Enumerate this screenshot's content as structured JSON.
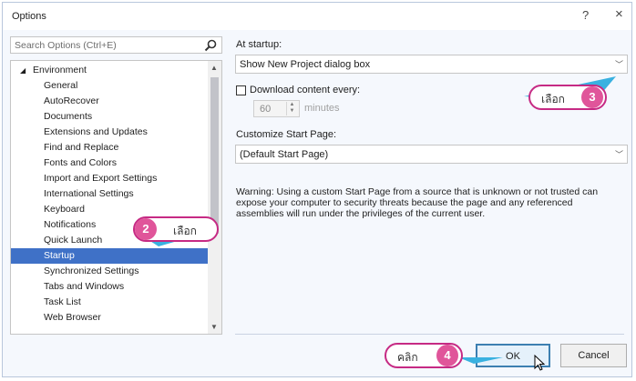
{
  "window": {
    "title": "Options",
    "help_label": "?",
    "close_label": "×"
  },
  "search": {
    "placeholder": "Search Options (Ctrl+E)"
  },
  "tree": {
    "root_label": "Environment",
    "items": [
      {
        "label": "General"
      },
      {
        "label": "AutoRecover"
      },
      {
        "label": "Documents"
      },
      {
        "label": "Extensions and Updates"
      },
      {
        "label": "Find and Replace"
      },
      {
        "label": "Fonts and Colors"
      },
      {
        "label": "Import and Export Settings"
      },
      {
        "label": "International Settings"
      },
      {
        "label": "Keyboard"
      },
      {
        "label": "Notifications"
      },
      {
        "label": "Quick Launch"
      },
      {
        "label": "Startup"
      },
      {
        "label": "Synchronized Settings"
      },
      {
        "label": "Tabs and Windows"
      },
      {
        "label": "Task List"
      },
      {
        "label": "Web Browser"
      }
    ],
    "selected": "Startup"
  },
  "startup": {
    "at_startup_label": "At startup:",
    "at_startup_value": "Show New Project dialog box",
    "download_label": "Download content every:",
    "download_value": "60",
    "minutes_label": "minutes",
    "custom_start_label": "Customize Start Page:",
    "custom_start_value": "(Default Start Page)",
    "warning_line1": "Warning: Using a custom Start Page from a source that is unknown or not trusted can",
    "warning_line2": "expose your computer to security threats because the page and any referenced",
    "warning_line3": "assemblies will run under the privileges of the current user."
  },
  "buttons": {
    "ok": "OK",
    "cancel": "Cancel"
  },
  "callouts": [
    {
      "number": "2",
      "text": "เลือก"
    },
    {
      "number": "3",
      "text": "เลือก"
    },
    {
      "number": "4",
      "text": "คลิก"
    }
  ],
  "colors": {
    "selection": "#3f71c7",
    "callout_border": "#c62a84",
    "badge": "#e0559a",
    "arrow": "#39b1e0"
  }
}
